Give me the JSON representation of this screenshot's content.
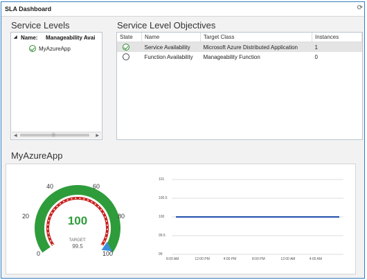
{
  "window": {
    "title": "SLA Dashboard",
    "refresh_icon": "refresh-icon"
  },
  "service_levels": {
    "title": "Service Levels",
    "header": {
      "name_label": "Name:",
      "name_value": "Manageability Avai"
    },
    "rows": [
      {
        "state": "healthy",
        "name": "MyAzureApp"
      }
    ]
  },
  "objectives": {
    "title": "Service Level Objectives",
    "columns": [
      "State",
      "Name",
      "Target Class",
      "Instances"
    ],
    "rows": [
      {
        "state": "healthy",
        "name": "Service Availability",
        "target_class": "Microsoft Azure Distributed Application",
        "instances": "1"
      },
      {
        "state": "unknown",
        "name": "Function Availability",
        "target_class": "Manageability Function",
        "instances": "0"
      }
    ]
  },
  "app_section": {
    "title": "MyAzureApp",
    "gauge": {
      "value": "100",
      "target_label": "TARGET:",
      "target_value": "99.5",
      "min": 0,
      "max": 100,
      "ticks": [
        "0",
        "20",
        "40",
        "60",
        "80",
        "100"
      ],
      "colors": {
        "good": "#2e9c3a",
        "bad": "#c8201e",
        "marker": "#3a8fd8"
      }
    }
  },
  "chart_data": {
    "type": "line",
    "y_ticks": [
      "101",
      "100.5",
      "100",
      "99.5",
      "99"
    ],
    "ylim": [
      99,
      101
    ],
    "x_ticks": [
      "8:00 AM",
      "12:00 PM",
      "4:00 PM",
      "8:00 PM",
      "12:00 AM",
      "4:00 AM"
    ],
    "series": [
      {
        "values": [
          100,
          100,
          100,
          100,
          100,
          100
        ],
        "color": "#1f4fa8"
      }
    ],
    "grid": true
  }
}
